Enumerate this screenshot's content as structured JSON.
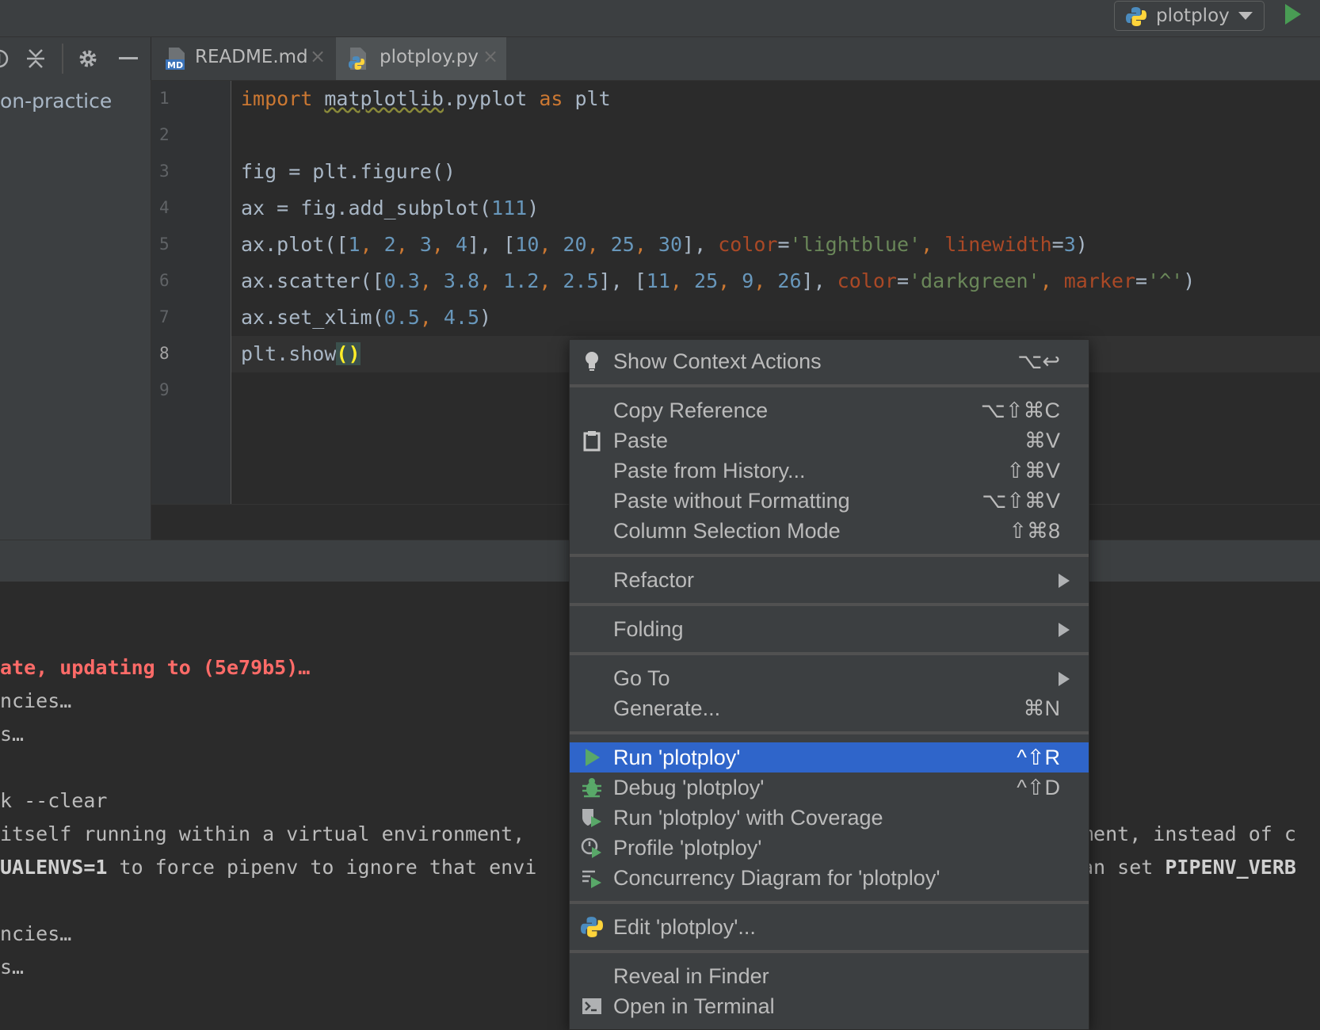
{
  "toolbar": {
    "run_config_label": "plotploy"
  },
  "project": {
    "root_label": "on-practice"
  },
  "tabs": [
    {
      "label": "README.md",
      "icon": "markdown-file-icon",
      "active": false
    },
    {
      "label": "plotploy.py",
      "icon": "python-file-icon",
      "active": true
    }
  ],
  "editor": {
    "line_numbers": [
      "1",
      "2",
      "3",
      "4",
      "5",
      "6",
      "7",
      "8",
      "9"
    ],
    "current_line": "8",
    "lines": {
      "l1": {
        "kw_import": "import",
        "mod": "matplotlib",
        "rest": ".pyplot ",
        "kw_as": "as",
        "alias": " plt"
      },
      "l3": {
        "text": "fig = plt.figure()"
      },
      "l4": {
        "pre": "ax = fig.add_subplot(",
        "n": "111",
        "post": ")"
      },
      "l5": {
        "t0": "ax.plot([",
        "a": "1",
        "c1": ", ",
        "b": "2",
        "c2": ", ",
        "c": "3",
        "c3": ", ",
        "d": "4",
        "t1": "], [",
        "e": "10",
        "c4": ", ",
        "f": "20",
        "c5": ", ",
        "g": "25",
        "c6": ", ",
        "h": "30",
        "t2": "], ",
        "p1": "color",
        "eq1": "=",
        "s1": "'lightblue'",
        "t3": ", ",
        "p2": "linewidth",
        "eq2": "=",
        "n1": "3",
        "t4": ")"
      },
      "l6": {
        "t0": "ax.scatter([",
        "a": "0.3",
        "c1": ", ",
        "b": "3.8",
        "c2": ", ",
        "c": "1.2",
        "c3": ", ",
        "d": "2.5",
        "t1": "], [",
        "e": "11",
        "c4": ", ",
        "f": "25",
        "c5": ", ",
        "g": "9",
        "c6": ", ",
        "h": "26",
        "t2": "], ",
        "p1": "color",
        "eq1": "=",
        "s1": "'darkgreen'",
        "t3": ", ",
        "p2": "marker",
        "eq2": "=",
        "s2": "'^'",
        "t4": ")"
      },
      "l7": {
        "t0": "ax.set_xlim(",
        "a": "0.5",
        "c1": ", ",
        "b": "4.5",
        "t1": ")"
      },
      "l8": {
        "t0": "plt.show",
        "brace": "()"
      }
    }
  },
  "terminal": {
    "lines": [
      "ate, updating to (5e79b5)…",
      "ncies…",
      "s…",
      "k --clear",
      "itself running within a virtual environment,",
      "UALENVS=1",
      " to force pipenv to ignore that envi",
      "ment, instead of c",
      "an set ",
      "PIPENV_VERB",
      "ncies…",
      "s…"
    ]
  },
  "context_menu": {
    "items": [
      {
        "label": "Show Context Actions",
        "shortcut": "⌥↩",
        "icon": "lightbulb-icon"
      },
      {
        "label": "Copy Reference",
        "shortcut": "⌥⇧⌘C"
      },
      {
        "label": "Paste",
        "shortcut": "⌘V",
        "icon": "clipboard-icon"
      },
      {
        "label": "Paste from History...",
        "shortcut": "⇧⌘V"
      },
      {
        "label": "Paste without Formatting",
        "shortcut": "⌥⇧⌘V"
      },
      {
        "label": "Column Selection Mode",
        "shortcut": "⇧⌘8"
      },
      {
        "label": "Refactor",
        "submenu": true
      },
      {
        "label": "Folding",
        "submenu": true
      },
      {
        "label": "Go To",
        "submenu": true
      },
      {
        "label": "Generate...",
        "shortcut": "⌘N"
      },
      {
        "label": "Run 'plotploy'",
        "shortcut": "^⇧R",
        "icon": "run-icon",
        "selected": true
      },
      {
        "label": "Debug 'plotploy'",
        "shortcut": "^⇧D",
        "icon": "debug-icon"
      },
      {
        "label": "Run 'plotploy' with Coverage",
        "icon": "coverage-icon"
      },
      {
        "label": "Profile 'plotploy'",
        "icon": "profile-icon"
      },
      {
        "label": "Concurrency Diagram for 'plotploy'",
        "icon": "concurrency-icon"
      },
      {
        "label": "Edit 'plotploy'...",
        "icon": "python-icon"
      },
      {
        "label": "Reveal in Finder"
      },
      {
        "label": "Open in Terminal",
        "icon": "terminal-icon"
      }
    ]
  },
  "colors": {
    "menu_selection": "#2f65ca",
    "run_green": "#499c54",
    "keyword": "#cc7832",
    "number": "#6897bb",
    "string": "#6a8759",
    "param": "#aa4926",
    "error_text": "#ff6b68"
  }
}
